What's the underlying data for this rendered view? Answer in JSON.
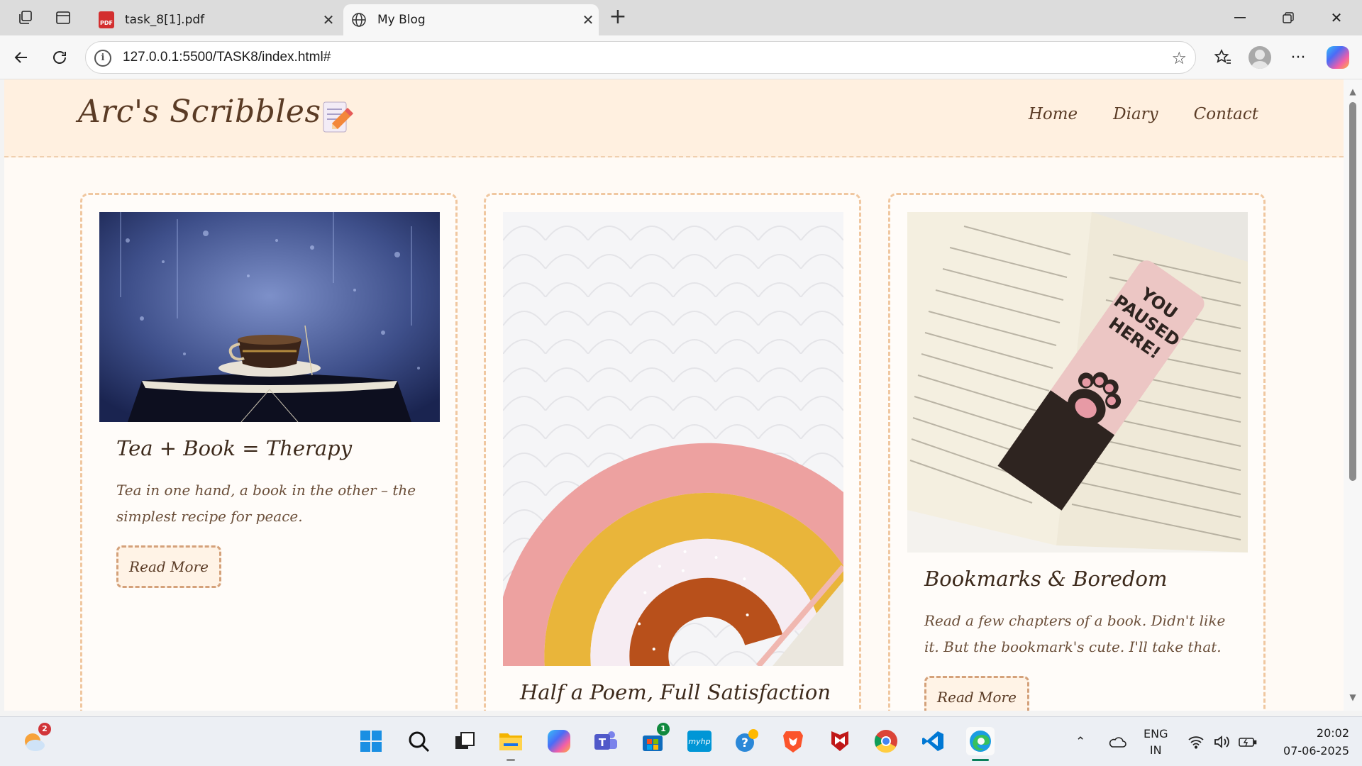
{
  "browser": {
    "tabs": [
      {
        "title": "task_8[1].pdf",
        "favicon": "pdf-icon",
        "active": false
      },
      {
        "title": "My Blog",
        "favicon": "globe-icon",
        "active": true
      }
    ],
    "address": {
      "host": "127.0.0.1",
      "path": ":5500/TASK8/index.html#"
    }
  },
  "site": {
    "logo": "Arc's Scribbles..",
    "nav": [
      "Home",
      "Diary",
      "Contact"
    ]
  },
  "cards": [
    {
      "title": "Tea + Book = Therapy",
      "text": "Tea in one hand, a book in the other – the simplest recipe for peace.",
      "button": "Read More"
    },
    {
      "title": "Half a Poem, Full Satisfaction"
    },
    {
      "title": "Bookmarks & Boredom",
      "text": "Read a few chapters of a book. Didn't like it. But the bookmark's cute. I'll take that.",
      "button": "Read More",
      "bookmark_text": [
        "YOU",
        "PAUSED",
        "HERE!"
      ]
    }
  ],
  "taskbar": {
    "weather_badge": "2",
    "store_badge": "1",
    "hp_label": "myhp",
    "lang": {
      "top": "ENG",
      "bottom": "IN"
    },
    "time": "20:02",
    "date": "07-06-2025"
  },
  "colors": {
    "header_bg": "#fff0e0",
    "page_bg": "#fffaf5",
    "border_dashed": "#f0c7a0",
    "text_brown": "#5a3b25"
  }
}
